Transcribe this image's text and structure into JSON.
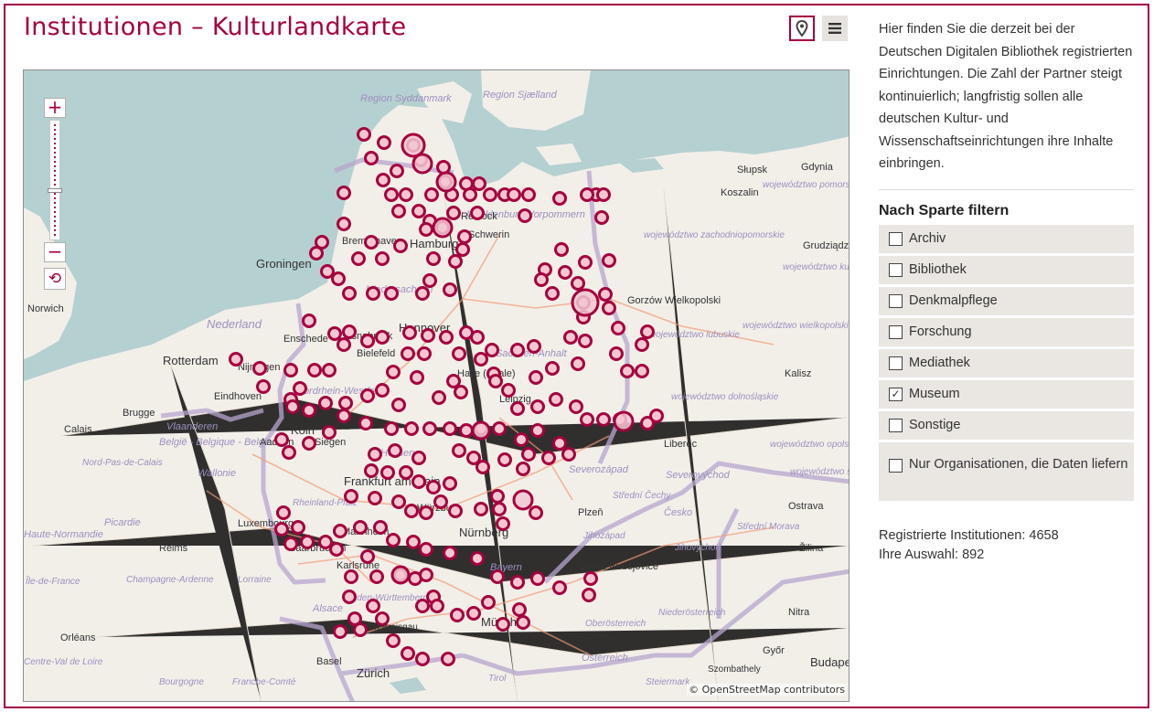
{
  "header": {
    "title": "Institutionen – Kulturlandkarte",
    "view_map_icon": "map-pin-icon",
    "view_list_icon": "list-icon"
  },
  "sidebar": {
    "intro": "Hier finden Sie die derzeit bei der Deutschen Digitalen Bibliothek registrierten Einrichtungen. Die Zahl der Partner steigt kontinuierlich; langfristig sollen alle deutschen Kultur- und Wissenschaftseinrichtungen ihre Inhalte einbringen.",
    "filter_heading": "Nach Sparte filtern",
    "filters": [
      {
        "label": "Archiv",
        "checked": false
      },
      {
        "label": "Bibliothek",
        "checked": false
      },
      {
        "label": "Denkmalpflege",
        "checked": false
      },
      {
        "label": "Forschung",
        "checked": false
      },
      {
        "label": "Mediathek",
        "checked": false
      },
      {
        "label": "Museum",
        "checked": true
      },
      {
        "label": "Sonstige",
        "checked": false
      },
      {
        "label": "Nur Organisationen, die Daten liefern",
        "checked": false
      }
    ],
    "stats": {
      "registered": "Registrierte Institutionen: 4658",
      "selection": "Ihre Auswahl: 892"
    }
  },
  "map": {
    "zoom_in": "+",
    "zoom_out": "−",
    "reset_icon": "reset-view-icon",
    "attribution": "© OpenStreetMap contributors",
    "labels": {
      "region_syddanmark": "Region Syddanmark",
      "region_sjaelland": "Region Sjælland",
      "slupsk": "Słupsk",
      "gdynia": "Gdynia",
      "koszalin": "Koszalin",
      "pomorskie": "województwo pomorskie",
      "zachodniopomorskie": "województwo zachodniopomorskie",
      "grudziadz": "Grudziądz",
      "kujawsko": "województwo kujawsko-pomorskie",
      "gorzow": "Gorzów Wielkopolski",
      "wielkopolskie": "województwo wielkopolskie",
      "lubuskie": "województwo lubuskie",
      "kalisz": "Kalisz",
      "dolnoslaskie": "województwo dolnośląskie",
      "opolskie": "województwo opolskie",
      "slaskie": "województwo śląskie",
      "mecklenburg": "Mecklenburg-Vorpommern",
      "rostock": "Rostock",
      "schwerin": "Schwerin",
      "hamburg": "Hamburg",
      "bremerhaven": "Bremerhaven",
      "groningen": "Groningen",
      "niedersachsen": "Niedersachsen",
      "hannover": "Hannover",
      "nederland": "Nederland",
      "enschede": "Enschede",
      "osnabrueck": "Osnabrück",
      "bielefeld": "Bielefeld",
      "sachsen_anhalt": "Sachsen-Anhalt",
      "norwich": "Norwich",
      "rotterdam": "Rotterdam",
      "nijmegen": "Nijmegen",
      "eindhoven": "Eindhoven",
      "nordrhein_westfalen": "Nordrhein-Westfalen",
      "brugge": "Brugge",
      "vlaanderen": "Vlaanderen",
      "calais": "Calais",
      "belgie": "België - Belgique - Belgien",
      "nord_pas_de_calais": "Nord-Pas-de-Calais",
      "wallonie": "Wallonie",
      "koeln": "Köln",
      "aachen": "Aachen",
      "siegen": "Siegen",
      "hessen": "Hessen",
      "halle": "Halle (Saale)",
      "leipzig": "Leipzig",
      "liberec": "Liberec",
      "severozapad": "Severozápad",
      "severovychod": "Severovýchod",
      "stredni_cechy": "Střední Čechy",
      "ostrava": "Ostrava",
      "frankfurt": "Frankfurt am Main",
      "rheinland_pfalz": "Rheinland-Pfalz",
      "wuerzburg": "Würzburg",
      "luxembourg": "Luxembourg",
      "picardie": "Picardie",
      "haute_normandie": "Haute-Normandie",
      "reims": "Reims",
      "saarbruecken": "Saarbrücken",
      "mannheim": "Mannheim",
      "nuernberg": "Nürnberg",
      "plzen": "Plzeň",
      "cesko": "Česko",
      "jihozapad": "Jihozápad",
      "jihovychod": "Jihovýchod",
      "stredni_morava": "Střední Morava",
      "zilina": "Žilina",
      "ile_de_france": "Île-de-France",
      "champagne": "Champagne-Ardenne",
      "lorraine": "Lorraine",
      "karlsruhe": "Karlsruhe",
      "bayern": "Bayern",
      "ceske_budejovice": "České Budějovice",
      "alsace": "Alsace",
      "baden_wuerttemberg": "Baden-Württemberg",
      "niederoesterreich": "Niederösterreich",
      "nitra": "Nitra",
      "orleans": "Orléans",
      "muenchen": "München",
      "oberoesterreich": "Oberösterreich",
      "freiburg": "Freiburg im Breisgau",
      "gyor": "Győr",
      "centre_val_de_loire": "Centre-Val de Loire",
      "basel": "Basel",
      "oesterreich": "Österreich",
      "bourgogne": "Bourgogne",
      "franche_comte": "Franche-Comté",
      "zuerich": "Zürich",
      "tirol": "Tirol",
      "steiermark": "Steiermark",
      "szombathely": "Szombathely",
      "budapest": "Budapest"
    }
  },
  "colors": {
    "accent": "#a5003e",
    "marker_fill": "#f2c7d2",
    "water": "#b5d0d0",
    "land": "#f2efe9",
    "border": "#b7a6ce"
  }
}
